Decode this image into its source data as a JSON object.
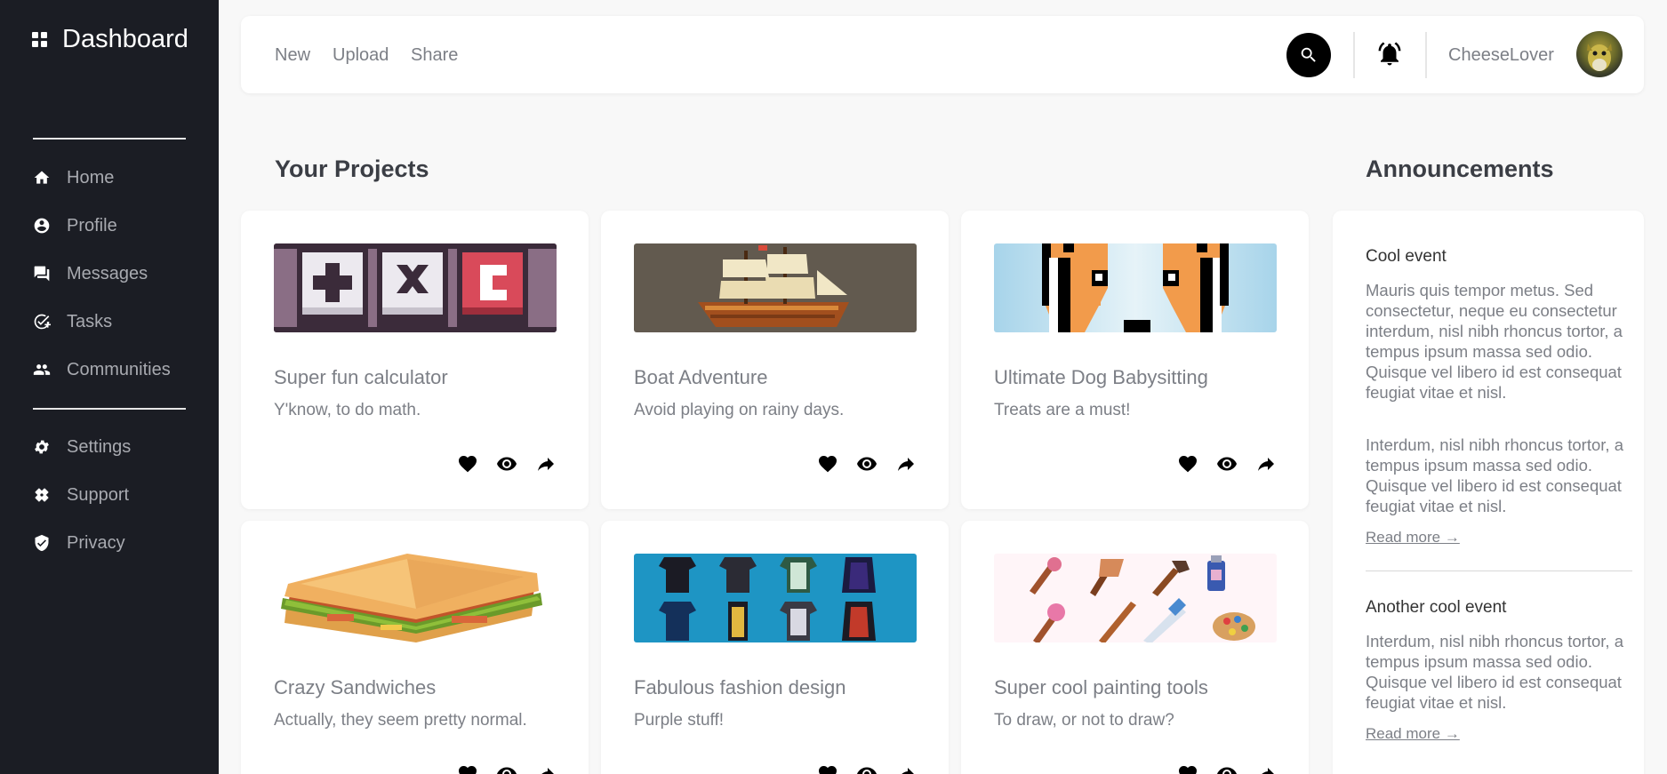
{
  "sidebar": {
    "brand": "Dashboard",
    "nav_primary": [
      {
        "label": "Home",
        "icon": "home-icon"
      },
      {
        "label": "Profile",
        "icon": "profile-icon"
      },
      {
        "label": "Messages",
        "icon": "messages-icon"
      },
      {
        "label": "Tasks",
        "icon": "tasks-icon"
      },
      {
        "label": "Communities",
        "icon": "communities-icon"
      }
    ],
    "nav_secondary": [
      {
        "label": "Settings",
        "icon": "gear-icon"
      },
      {
        "label": "Support",
        "icon": "support-icon"
      },
      {
        "label": "Privacy",
        "icon": "shield-icon"
      }
    ]
  },
  "topbar": {
    "links": [
      "New",
      "Upload",
      "Share"
    ],
    "username": "CheeseLover"
  },
  "projects": {
    "heading": "Your Projects",
    "items": [
      {
        "title": "Super fun calculator",
        "description": "Y'know, to do math."
      },
      {
        "title": "Boat Adventure",
        "description": "Avoid playing on rainy days."
      },
      {
        "title": "Ultimate Dog Babysitting",
        "description": "Treats are a must!"
      },
      {
        "title": "Crazy Sandwiches",
        "description": "Actually, they seem pretty normal."
      },
      {
        "title": "Fabulous fashion design",
        "description": "Purple stuff!"
      },
      {
        "title": "Super cool painting tools",
        "description": "To draw, or not to draw?"
      }
    ]
  },
  "announcements": {
    "heading": "Announcements",
    "items": [
      {
        "title": "Cool event",
        "paragraphs": [
          "Mauris quis tempor metus. Sed consectetur, neque eu consectetur interdum, nisl nibh rhoncus tortor, a tempus ipsum massa sed odio. Quisque vel libero id est consequat feugiat vitae et nisl.",
          "Interdum, nisl nibh rhoncus tortor, a tempus ipsum massa sed odio. Quisque vel libero id est consequat feugiat vitae et nisl."
        ],
        "link": "Read more →"
      },
      {
        "title": "Another cool event",
        "paragraphs": [
          "Interdum, nisl nibh rhoncus tortor, a tempus ipsum massa sed odio. Quisque vel libero id est consequat feugiat vitae et nisl."
        ],
        "link": "Read more →"
      }
    ]
  },
  "colors": {
    "sidebar_bg": "#1b1d24",
    "page_bg": "#f8f8f8",
    "muted_text": "#7c7f86",
    "accent": "#000000"
  }
}
